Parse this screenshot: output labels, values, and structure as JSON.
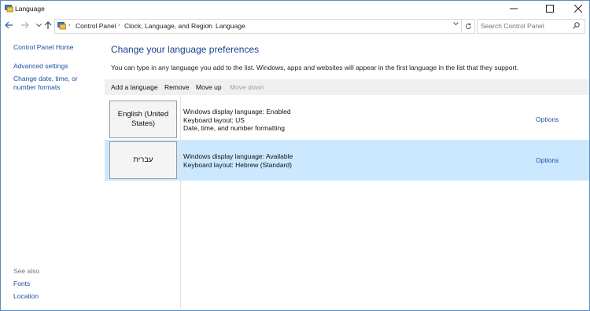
{
  "window": {
    "title": "Language"
  },
  "address": {
    "crumbs": [
      "Control Panel",
      "Clock, Language, and Region",
      "Language"
    ],
    "search_placeholder": "Search Control Panel"
  },
  "sidebar": {
    "links": [
      "Control Panel Home",
      "Advanced settings",
      "Change date, time, or number formats"
    ],
    "see_also_label": "See also",
    "see_also_links": [
      "Fonts",
      "Location"
    ]
  },
  "main": {
    "title": "Change your language preferences",
    "description": "You can type in any language you add to the list. Windows, apps and websites will appear in the first language in the list that they support.",
    "toolbar": [
      "Add a language",
      "Remove",
      "Move up",
      "Move down"
    ],
    "languages": [
      {
        "name": "English (United States)",
        "details": [
          "Windows display language: Enabled",
          "Keyboard layout: US",
          "Date, time, and number formatting"
        ],
        "options": "Options"
      },
      {
        "name": "עברית",
        "details": [
          "Windows display language: Available",
          "Keyboard layout: Hebrew (Standard)"
        ],
        "options": "Options"
      }
    ]
  },
  "colors": {
    "link": "#1b4fa3",
    "selected_row": "#cce8ff",
    "title": "#1b3f8f"
  },
  "icons": [
    "control-panel-icon",
    "back-arrow-icon",
    "forward-arrow-icon",
    "chevron-down-icon",
    "up-arrow-icon",
    "refresh-icon",
    "search-icon",
    "minimize-icon",
    "maximize-icon",
    "close-icon"
  ]
}
